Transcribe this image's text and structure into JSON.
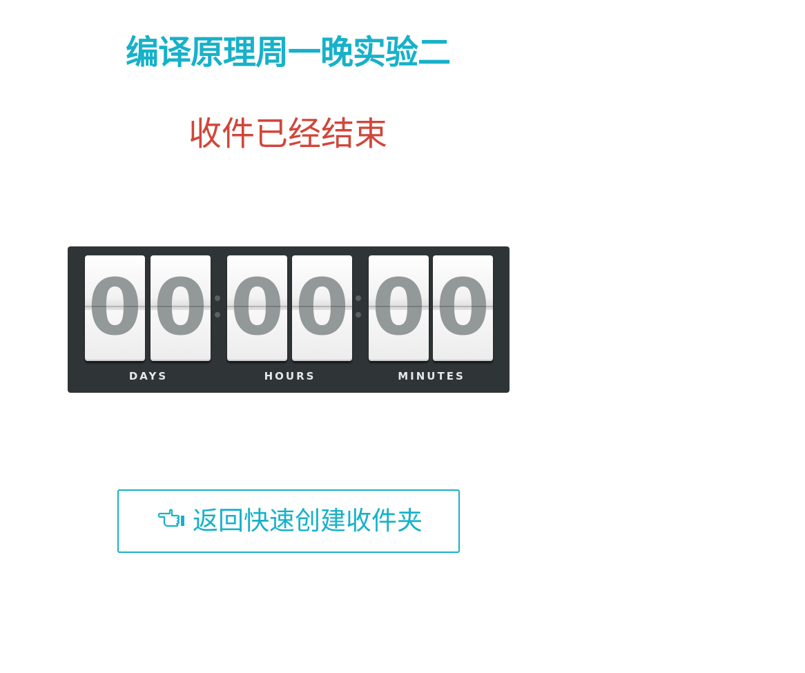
{
  "header": {
    "title": "编译原理周一晚实验二",
    "status": "收件已经结束"
  },
  "countdown": {
    "days": [
      "0",
      "0"
    ],
    "hours": [
      "0",
      "0"
    ],
    "minutes": [
      "0",
      "0"
    ],
    "labels": {
      "days": "DAYS",
      "hours": "HOURS",
      "minutes": "MINUTES"
    }
  },
  "back_button": {
    "icon": "hand-pointing-icon",
    "label": "返回快速创建收件夹"
  },
  "colors": {
    "accent": "#17b1c9",
    "status": "#d0463a",
    "counter_bg": "#2f3437"
  }
}
